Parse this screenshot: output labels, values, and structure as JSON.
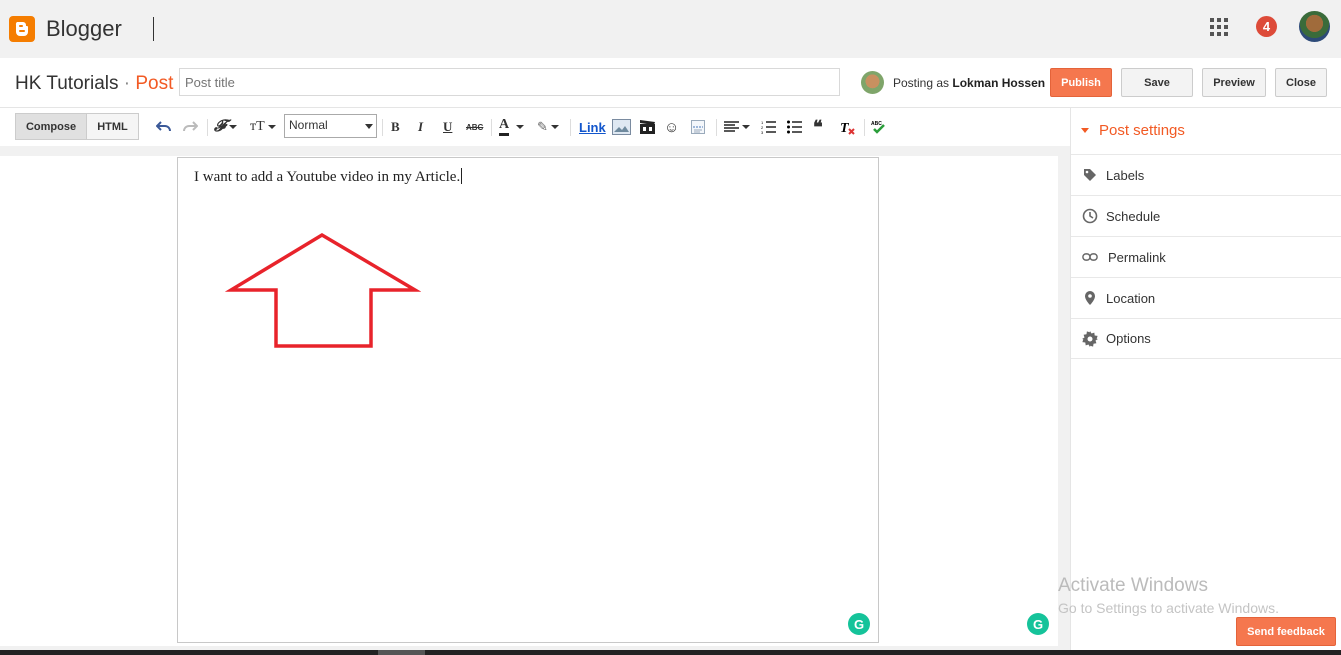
{
  "app": {
    "name": "Blogger",
    "notifications": "4"
  },
  "post": {
    "blog_name": "HK Tutorials",
    "separator": "·",
    "section": "Post",
    "title_placeholder": "Post title",
    "posting_as_label": "Posting as",
    "author": "Lokman Hossen",
    "body_text": "I want to add a Youtube video in my Article."
  },
  "actions": {
    "publish": "Publish",
    "save": "Save",
    "preview": "Preview",
    "close": "Close"
  },
  "mode_tabs": {
    "compose": "Compose",
    "html": "HTML"
  },
  "toolbar": {
    "format_select": "Normal",
    "link_label": "Link",
    "icons": [
      "undo-icon",
      "redo-icon",
      "font-family-icon",
      "font-size-icon",
      "bold-icon",
      "italic-icon",
      "underline-icon",
      "strikethrough-icon",
      "text-color-icon",
      "highlight-icon",
      "image-icon",
      "video-icon",
      "emoji-icon",
      "jump-break-icon",
      "align-icon",
      "numbered-list-icon",
      "bulleted-list-icon",
      "quote-icon",
      "clear-format-icon",
      "spellcheck-icon"
    ]
  },
  "sidebar": {
    "heading": "Post settings",
    "items": [
      {
        "label": "Labels",
        "icon": "tag-icon"
      },
      {
        "label": "Schedule",
        "icon": "clock-icon"
      },
      {
        "label": "Permalink",
        "icon": "link-icon"
      },
      {
        "label": "Location",
        "icon": "pin-icon"
      },
      {
        "label": "Options",
        "icon": "gear-icon"
      }
    ]
  },
  "watermark": {
    "line1": "Activate Windows",
    "line2": "Go to Settings to activate Windows."
  },
  "feedback_label": "Send feedback",
  "colors": {
    "accent": "#f25a24",
    "publish": "#f5774e",
    "annotation_arrow": "#e8232b",
    "grammarly": "#15c39a"
  }
}
